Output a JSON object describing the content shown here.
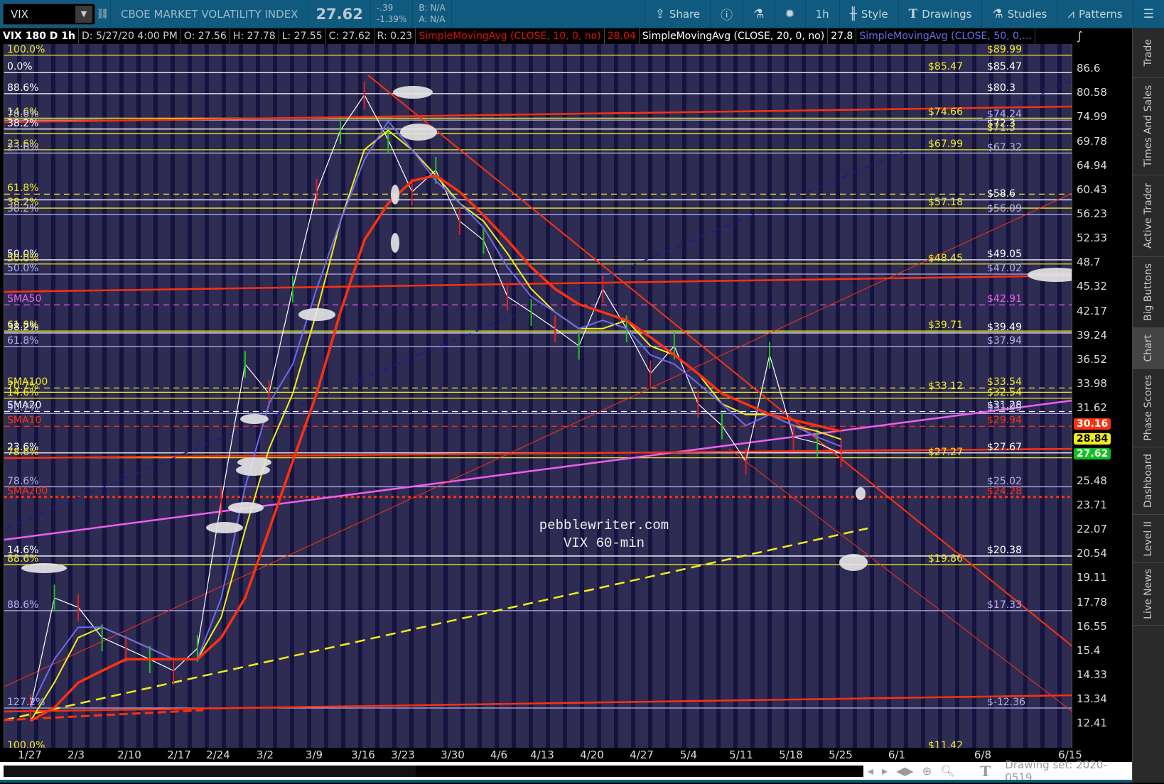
{
  "toolbar": {
    "symbol": "VIX",
    "title": "CBOE MARKET VOLATILITY INDEX",
    "last": "27.62",
    "change": "-.39",
    "change_pct": "-1.39%",
    "bid": "B: N/A",
    "ask": "A: N/A",
    "buttons": [
      {
        "label": "Share",
        "icon": "share-icon"
      },
      {
        "label": "",
        "icon": "info-icon"
      },
      {
        "label": "",
        "icon": "flask-icon"
      },
      {
        "label": "",
        "icon": "gear-icon"
      },
      {
        "label": "1h",
        "icon": ""
      },
      {
        "label": "Style",
        "icon": "candle-icon"
      },
      {
        "label": "Drawings",
        "icon": "text-t-icon"
      },
      {
        "label": "Studies",
        "icon": "flask-icon"
      },
      {
        "label": "Patterns",
        "icon": "patterns-icon"
      },
      {
        "label": "",
        "icon": "menu-icon"
      }
    ]
  },
  "header": {
    "title": "VIX 180 D 1h",
    "date": "D: 5/27/20 4:00 PM",
    "open": "O: 27.56",
    "high": "H: 27.78",
    "low": "L: 27.55",
    "close": "C: 27.62",
    "range": "R: 0.23",
    "sma10": "SimpleMovingAvg (CLOSE, 10, 0, no)",
    "sma10_val": "28.04",
    "sma20": "SimpleMovingAvg (CLOSE, 20, 0, no)",
    "sma20_val": "27.8",
    "sma50": "SimpleMovingAvg (CLOSE, 50, 0,..."
  },
  "colors": {
    "yellow": "#f2ec1a",
    "white": "#ffffff",
    "lav": "#b4b0f0",
    "red": "#ff3010",
    "magenta": "#f060f0",
    "green": "#10c020",
    "blue": "#6a6af0"
  },
  "watermark": {
    "line1": "pebblewriter.com",
    "line2": "VIX 60-min"
  },
  "chart_data": {
    "type": "line",
    "scale": "log",
    "ylim": [
      12.0,
      92.0
    ],
    "x_ticks": [
      "1/27",
      "2/3",
      "2/10",
      "2/17",
      "2/24",
      "3/2",
      "3/9",
      "3/16",
      "3/23",
      "3/30",
      "4/6",
      "4/13",
      "4/20",
      "4/27",
      "5/4",
      "5/11",
      "5/18",
      "5/25",
      "6/1",
      "6/8",
      "6/15"
    ],
    "y_ticks": [
      "86.6",
      "80.58",
      "74.99",
      "69.78",
      "64.94",
      "60.43",
      "56.23",
      "52.33",
      "48.7",
      "45.32",
      "42.17",
      "39.24",
      "36.52",
      "33.98",
      "31.62",
      "25.48",
      "23.71",
      "22.07",
      "20.54",
      "19.11",
      "17.78",
      "16.55",
      "15.4",
      "14.33",
      "13.34",
      "12.41"
    ],
    "x_week": [
      0,
      0.5,
      1,
      1.5,
      2,
      2.5,
      3,
      3.5,
      4,
      4.5,
      5,
      5.5,
      6,
      6.5,
      7,
      7.5,
      8,
      8.5,
      9,
      9.5,
      10,
      10.5,
      11,
      11.5,
      12,
      12.5,
      13,
      13.5,
      14,
      14.5,
      15,
      15.5,
      16,
      16.5,
      17
    ],
    "series": [
      {
        "name": "VIX",
        "color": "#ffffff",
        "values": [
          13,
          18,
          17.5,
          16,
          15.5,
          15,
          14.5,
          15.5,
          24,
          36,
          33,
          45,
          60,
          72,
          80,
          70,
          60,
          64,
          55,
          52,
          44,
          42,
          40,
          38,
          45,
          40,
          35,
          38,
          32,
          30,
          27,
          37,
          29,
          28.5,
          27.6
        ]
      },
      {
        "name": "SMA20",
        "color": "#f2ec1a",
        "values": [
          12.5,
          14,
          16,
          16.5,
          16,
          15.5,
          15,
          15,
          17,
          22,
          28,
          33,
          42,
          55,
          68,
          72,
          68,
          63,
          58,
          55,
          50,
          45,
          42,
          40,
          40,
          41,
          38,
          37,
          35,
          32,
          31,
          31,
          30,
          29.5,
          28.8
        ]
      },
      {
        "name": "SMA10",
        "color": "#6a6af0",
        "values": [
          13,
          15,
          16.5,
          16.5,
          16,
          15.5,
          15,
          15,
          18,
          25,
          32,
          36,
          45,
          55,
          66,
          74,
          68,
          62,
          58,
          54,
          48,
          44,
          42,
          40,
          41,
          40,
          37,
          36,
          34,
          32,
          30,
          31,
          30,
          29,
          28.2
        ]
      },
      {
        "name": "SMA50",
        "color": "#ff3010",
        "values": [
          12.5,
          13,
          14,
          14.5,
          15,
          15,
          15,
          15,
          16,
          18,
          22,
          27,
          33,
          42,
          52,
          58,
          62,
          63,
          60,
          56,
          52,
          48,
          45,
          43,
          42,
          41,
          39,
          37,
          35,
          33,
          32,
          31,
          30.5,
          30,
          29.5
        ]
      }
    ],
    "badges": [
      {
        "value": "30.16",
        "color": "#ff3010"
      },
      {
        "value": "28.84",
        "color": "#f2ec1a"
      },
      {
        "value": "27.62",
        "color": "#10c020"
      }
    ],
    "levels": [
      {
        "price": 89.99,
        "color": "yellow",
        "style": "solid",
        "left": "100.0%",
        "mid": "",
        "right": "$89.99"
      },
      {
        "price": 85.47,
        "color": "white",
        "style": "solid",
        "left": "0.0%",
        "mid": "$85.47",
        "right": "$85.47"
      },
      {
        "price": 80.3,
        "color": "white",
        "style": "solid",
        "left": "88.6%",
        "mid": "",
        "right": "$80.3"
      },
      {
        "price": 74.66,
        "color": "yellow",
        "style": "solid",
        "left": "14.6%",
        "mid": "$74.66",
        "right": ""
      },
      {
        "price": 74.24,
        "color": "lav",
        "style": "solid",
        "left": "78.6%",
        "mid": "",
        "right": "$74.24"
      },
      {
        "price": 72.3,
        "color": "white",
        "style": "solid",
        "left": "38.2%",
        "mid": "",
        "right": "$72.3"
      },
      {
        "price": 71.3,
        "color": "yellow",
        "style": "solid",
        "left": "",
        "mid": "",
        "right": "$71.3"
      },
      {
        "price": 67.99,
        "color": "yellow",
        "style": "solid",
        "left": "23.6%",
        "mid": "$67.99",
        "right": ""
      },
      {
        "price": 67.32,
        "color": "lav",
        "style": "solid",
        "left": "23.6%",
        "mid": "",
        "right": "$67.32"
      },
      {
        "price": 59.6,
        "color": "yellow",
        "style": "dash",
        "left": "61.8%",
        "mid": "",
        "right": ""
      },
      {
        "price": 58.6,
        "color": "white",
        "style": "solid",
        "left": "",
        "mid": "",
        "right": "$58.6"
      },
      {
        "price": 57.18,
        "color": "yellow",
        "style": "solid",
        "left": "38.2%",
        "mid": "$57.18",
        "right": ""
      },
      {
        "price": 56.09,
        "color": "lav",
        "style": "solid",
        "left": "38.2%",
        "mid": "",
        "right": "$56.09"
      },
      {
        "price": 49.05,
        "color": "white",
        "style": "solid",
        "left": "50.0%",
        "mid": "",
        "right": "$49.05"
      },
      {
        "price": 48.45,
        "color": "yellow",
        "style": "solid",
        "left": "50.0%",
        "mid": "$48.45",
        "right": ""
      },
      {
        "price": 47.02,
        "color": "lav",
        "style": "solid",
        "left": "50.0%",
        "mid": "",
        "right": "$47.02"
      },
      {
        "price": 42.91,
        "color": "magenta",
        "style": "dash",
        "left": "SMA50",
        "mid": "",
        "right": "$42.91"
      },
      {
        "price": 39.71,
        "color": "yellow",
        "style": "solid",
        "left": "61.8%",
        "mid": "$39.71",
        "right": ""
      },
      {
        "price": 39.49,
        "color": "white",
        "style": "solid",
        "left": "38.2%",
        "mid": "",
        "right": "$39.49"
      },
      {
        "price": 37.94,
        "color": "lav",
        "style": "solid",
        "left": "61.8%",
        "mid": "",
        "right": "$37.94"
      },
      {
        "price": 33.54,
        "color": "yellow",
        "style": "dash",
        "left": "SMA100",
        "mid": "",
        "right": "$33.54"
      },
      {
        "price": 33.12,
        "color": "yellow",
        "style": "solid",
        "left": "70.7%",
        "mid": "$33.12",
        "right": ""
      },
      {
        "price": 32.54,
        "color": "yellow",
        "style": "solid",
        "left": "14.6%",
        "mid": "",
        "right": "$32.54"
      },
      {
        "price": 31.28,
        "color": "white",
        "style": "dash",
        "left": "SMA20",
        "mid": "",
        "right": "$31.28"
      },
      {
        "price": 31.09,
        "color": "lav",
        "style": "solid",
        "left": "90.7%",
        "mid": "",
        "right": "$31.09"
      },
      {
        "price": 29.94,
        "color": "red",
        "style": "dash",
        "left": "SMA10",
        "mid": "",
        "right": "$29.94"
      },
      {
        "price": 27.67,
        "color": "white",
        "style": "solid",
        "left": "23.6%",
        "mid": "",
        "right": "$27.67"
      },
      {
        "price": 27.27,
        "color": "yellow",
        "style": "solid",
        "left": "78.6%",
        "mid": "$27.27",
        "right": ""
      },
      {
        "price": 25.02,
        "color": "lav",
        "style": "solid",
        "left": "78.6%",
        "mid": "",
        "right": "$25.02"
      },
      {
        "price": 24.28,
        "color": "red",
        "style": "dot",
        "left": "SMA200",
        "mid": "",
        "right": "$24.28"
      },
      {
        "price": 20.38,
        "color": "white",
        "style": "solid",
        "left": "14.6%",
        "mid": "",
        "right": "$20.38"
      },
      {
        "price": 19.86,
        "color": "yellow",
        "style": "solid",
        "left": "88.6%",
        "mid": "$19.86",
        "right": ""
      },
      {
        "price": 17.33,
        "color": "lav",
        "style": "solid",
        "left": "88.6%",
        "mid": "",
        "right": "$17.33"
      },
      {
        "price": 11.42,
        "color": "yellow",
        "style": "solid",
        "left": "100.0%",
        "mid": "$11.42",
        "right": ""
      },
      {
        "price": -12.36,
        "color": "lav",
        "style": "solid",
        "left": "127.2%",
        "mid": "",
        "right": "$-12.36"
      }
    ]
  },
  "status": {
    "drawing_set": "Drawing set: 2020-0519"
  },
  "tabs": [
    "Trade",
    "Times And Sales",
    "Active Trader",
    "Big Buttons",
    "Chart",
    "Phase Scores",
    "Dashboard",
    "Level II",
    "Live News"
  ]
}
